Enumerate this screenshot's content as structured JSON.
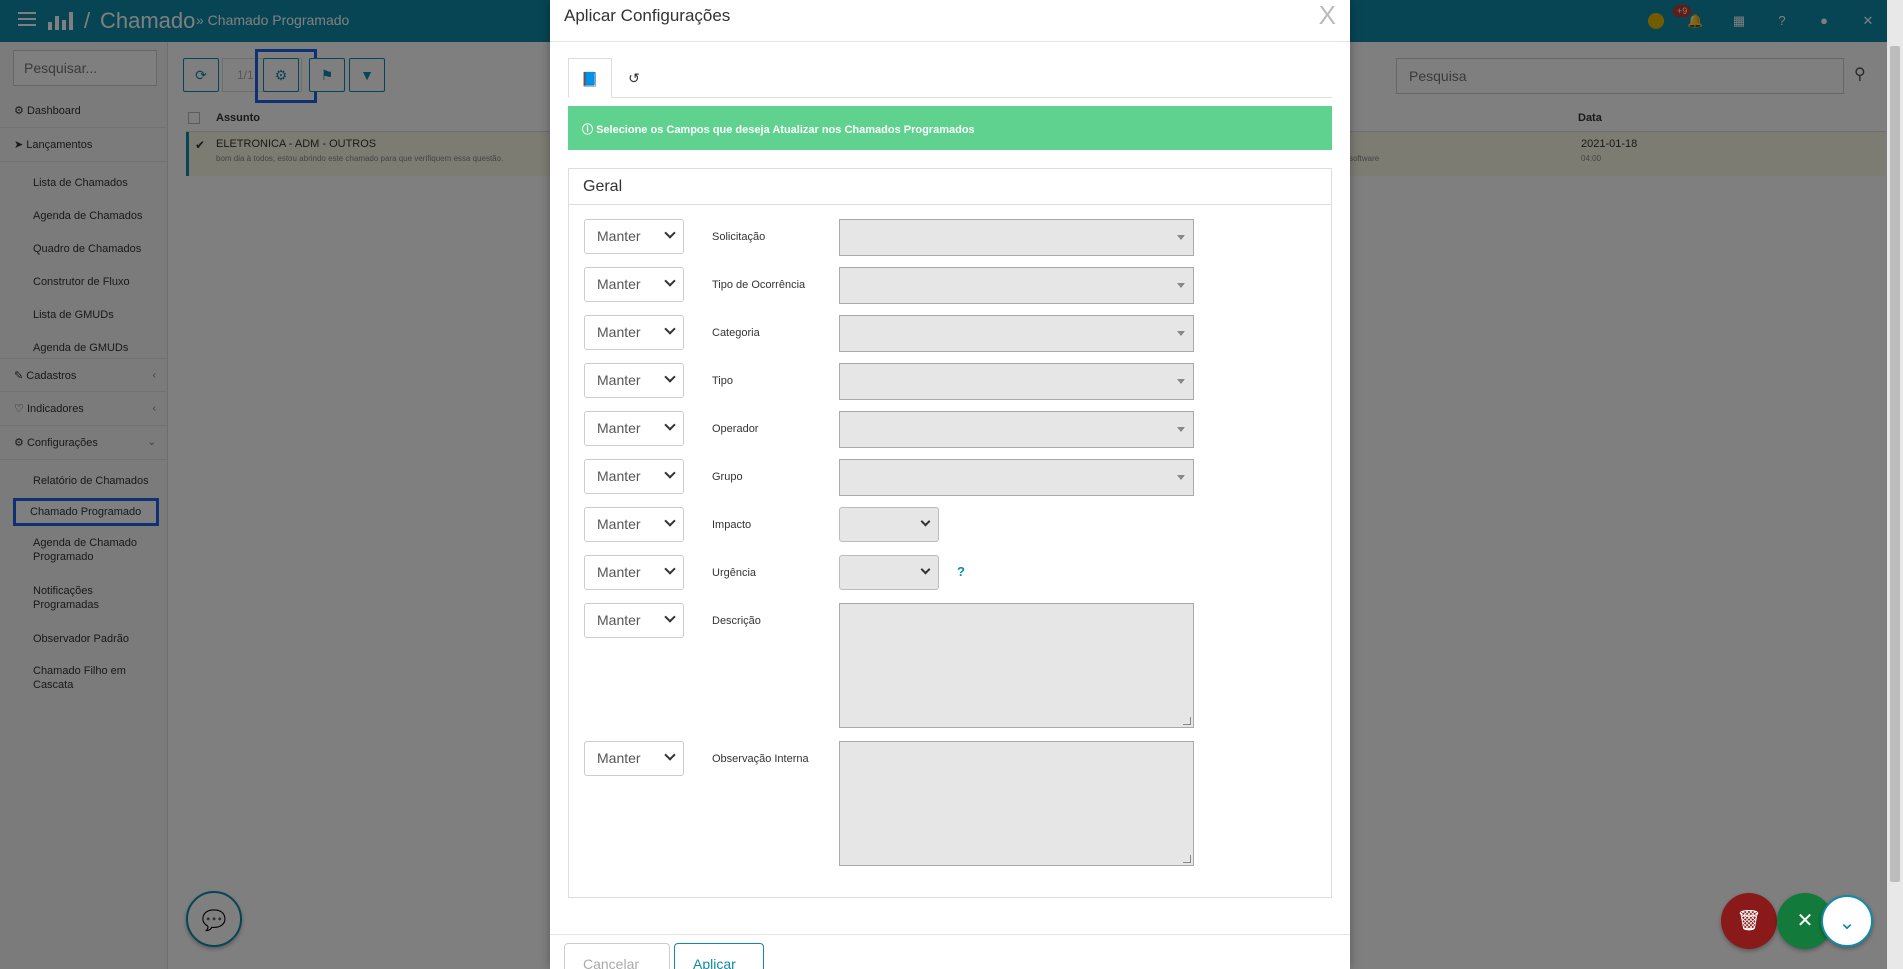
{
  "topbar": {
    "separator": "/",
    "title": "Chamado",
    "subcrumb": "» Chamado Programado",
    "notification_badge": "+9"
  },
  "sidebar": {
    "search_placeholder": "Pesquisar...",
    "items": [
      {
        "label": "Dashboard",
        "icon": "⚙"
      },
      {
        "label": "Lançamentos",
        "icon": "➤"
      },
      {
        "label": "Lista de Chamados"
      },
      {
        "label": "Agenda de Chamados"
      },
      {
        "label": "Quadro de Chamados"
      },
      {
        "label": "Construtor de Fluxo"
      },
      {
        "label": "Lista de GMUDs"
      },
      {
        "label": "Agenda de GMUDs"
      },
      {
        "label": "Cadastros",
        "icon": "✎"
      },
      {
        "label": "Indicadores",
        "icon": "♡"
      },
      {
        "label": "Configurações",
        "icon": "⚙"
      },
      {
        "label": "Relatório de Chamados"
      },
      {
        "label": "Chamado Programado"
      },
      {
        "label": "Agenda de Chamado Programado"
      },
      {
        "label": "Notificações Programadas"
      },
      {
        "label": "Observador Padrão"
      },
      {
        "label": "Chamado Filho em Cascata"
      }
    ]
  },
  "content": {
    "pager": "1/1",
    "search_placeholder": "Pesquisa",
    "columns": {
      "subject": "Assunto",
      "date": "Data"
    },
    "row": {
      "subject": "ELETRONICA - ADM - OUTROS",
      "description": "bom dia à todos, estou abrindo este chamado para que verifiquem essa questão.",
      "extra": "software",
      "date": "2021-01-18",
      "time": "04:00"
    }
  },
  "modal": {
    "title": "Aplicar Configurações",
    "close": "X",
    "alert": "Selecione os Campos que deseja Atualizar nos Chamados Programados",
    "panel_title": "Geral",
    "keep_label": "Manter",
    "fields": [
      {
        "label": "Solicitação",
        "type": "combo"
      },
      {
        "label": "Tipo de Ocorrência",
        "type": "combo"
      },
      {
        "label": "Categoria",
        "type": "combo"
      },
      {
        "label": "Tipo",
        "type": "combo"
      },
      {
        "label": "Operador",
        "type": "combo"
      },
      {
        "label": "Grupo",
        "type": "combo"
      },
      {
        "label": "Impacto",
        "type": "select"
      },
      {
        "label": "Urgência",
        "type": "select"
      },
      {
        "label": "Descrição",
        "type": "textarea"
      },
      {
        "label": "Observação Interna",
        "type": "textarea"
      }
    ],
    "help": "?",
    "footer": {
      "cancel": "Cancelar",
      "apply": "Aplicar"
    }
  },
  "colors": {
    "primary": "#0f8aa8",
    "alert": "#5fd28f",
    "highlight": "#1e62e6"
  }
}
